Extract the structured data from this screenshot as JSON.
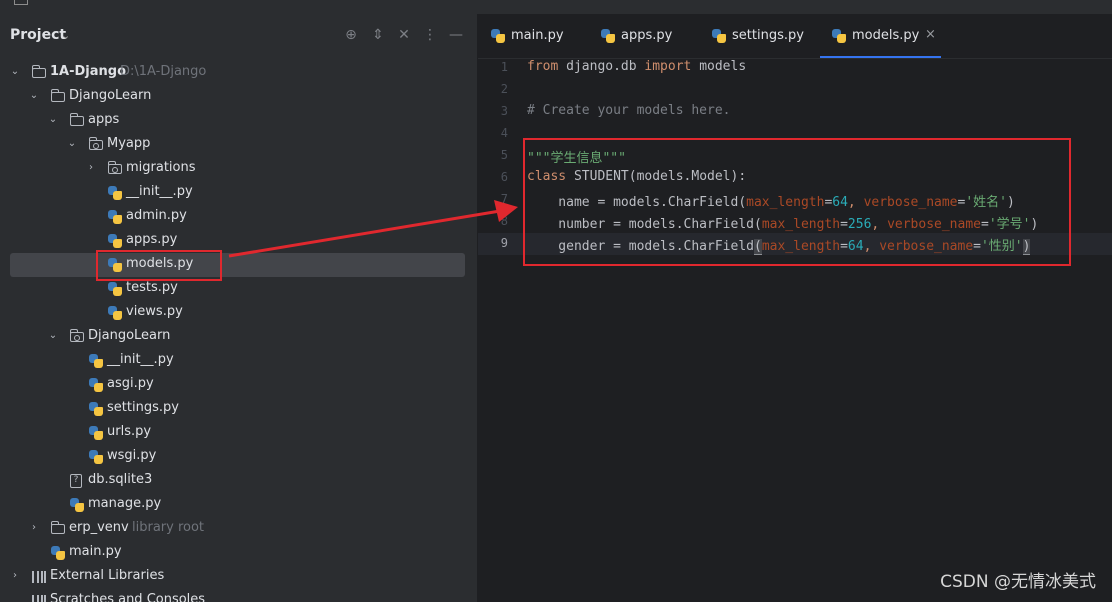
{
  "project_panel": {
    "title": "Project",
    "tree": [
      {
        "label": "1A-Django",
        "suffix": "D:\\1A-Django",
        "type": "root",
        "expanded": true
      },
      {
        "label": "DjangoLearn",
        "type": "folder",
        "expanded": true
      },
      {
        "label": "apps",
        "type": "folder",
        "expanded": true
      },
      {
        "label": "Myapp",
        "type": "package",
        "expanded": true
      },
      {
        "label": "migrations",
        "type": "package",
        "expanded": false
      },
      {
        "label": "__init__.py",
        "type": "python"
      },
      {
        "label": "admin.py",
        "type": "python"
      },
      {
        "label": "apps.py",
        "type": "python"
      },
      {
        "label": "models.py",
        "type": "python",
        "selected": true
      },
      {
        "label": "tests.py",
        "type": "python"
      },
      {
        "label": "views.py",
        "type": "python"
      },
      {
        "label": "DjangoLearn",
        "type": "package",
        "expanded": true
      },
      {
        "label": "__init__.py",
        "type": "python"
      },
      {
        "label": "asgi.py",
        "type": "python"
      },
      {
        "label": "settings.py",
        "type": "python"
      },
      {
        "label": "urls.py",
        "type": "python"
      },
      {
        "label": "wsgi.py",
        "type": "python"
      },
      {
        "label": "db.sqlite3",
        "type": "db"
      },
      {
        "label": "manage.py",
        "type": "python"
      },
      {
        "label": "erp_venv",
        "suffix": "library root",
        "type": "folder",
        "expanded": false
      },
      {
        "label": "main.py",
        "type": "python"
      },
      {
        "label": "External Libraries",
        "type": "library",
        "expanded": false
      },
      {
        "label": "Scratches and Consoles",
        "type": "scratch"
      }
    ]
  },
  "editor": {
    "tabs": [
      {
        "label": "main.py"
      },
      {
        "label": "apps.py"
      },
      {
        "label": "settings.py"
      },
      {
        "label": "models.py",
        "active": true,
        "close": "×"
      }
    ],
    "line_numbers": [
      "1",
      "2",
      "3",
      "4",
      "5",
      "6",
      "7",
      "8",
      "9"
    ],
    "lines": {
      "l1_from": "from",
      "l1_mod": " django.db ",
      "l1_import": "import",
      "l1_name": " models",
      "l3_comment": "# Create your models here.",
      "l5_doc": "\"\"\"学生信息\"\"\"",
      "l6_class": "class",
      "l6_rest": " STUDENT(models.Model):",
      "l7_a": "    name = models.CharField(",
      "l7_p1": "max_length",
      "l7_eq1": "=",
      "l7_n1": "64",
      "l7_c": ", ",
      "l7_p2": "verbose_name",
      "l7_eq2": "=",
      "l7_s": "'姓名'",
      "l7_end": ")",
      "l8_a": "    number = models.CharField(",
      "l8_p1": "max_length",
      "l8_eq1": "=",
      "l8_n1": "256",
      "l8_c": ", ",
      "l8_p2": "verbose_name",
      "l8_eq2": "=",
      "l8_s": "'学号'",
      "l8_end": ")",
      "l9_a": "    gender = models.CharField",
      "l9_open": "(",
      "l9_p1": "max_length",
      "l9_eq1": "=",
      "l9_n1": "64",
      "l9_c": ", ",
      "l9_p2": "verbose_name",
      "l9_eq2": "=",
      "l9_s": "'性别'",
      "l9_end": ")"
    },
    "current_line": 9
  },
  "watermark": "CSDN @无情冰美式",
  "colors": {
    "annotation": "#e0282e",
    "accent": "#3574f0"
  }
}
